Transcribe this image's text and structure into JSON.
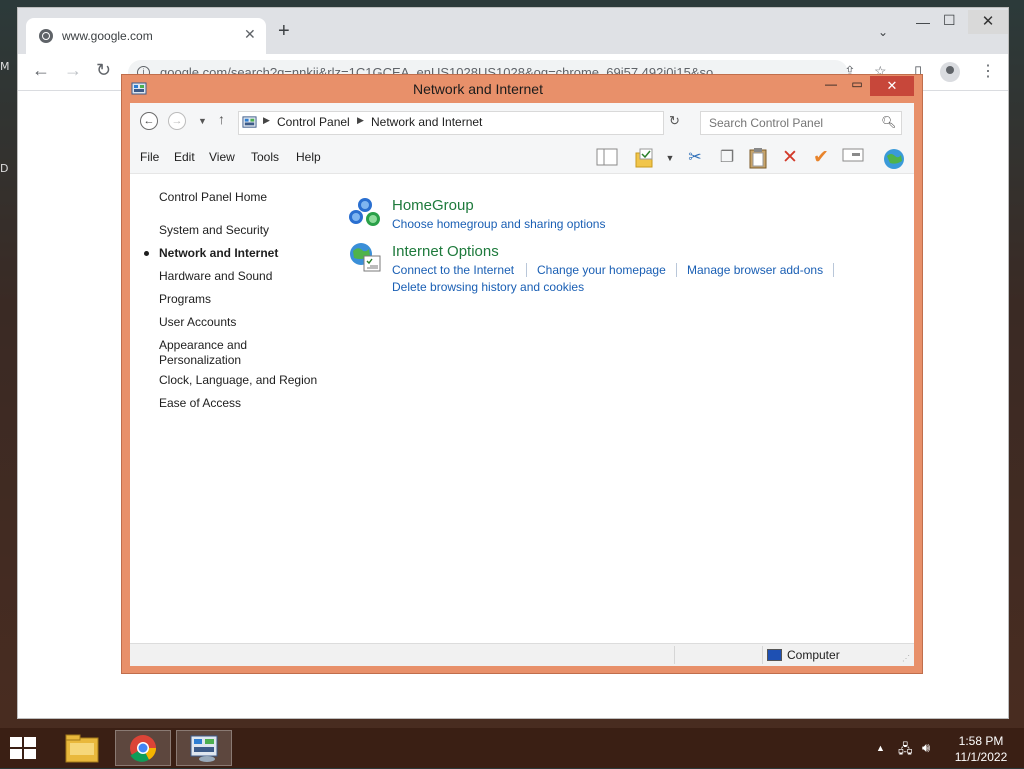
{
  "desktop": {
    "label_1": "M",
    "label_2": "D"
  },
  "browser": {
    "tab_title": "www.google.com",
    "tab_close": "✕",
    "new_tab": "+",
    "url": "google.com/search?q=nnkii&rlz=1C1GCEA_enUS1028US1028&oq=chrome_69i57.492j0j15&so",
    "window_minimize": "—",
    "window_maximize": "☐",
    "window_close": "✕"
  },
  "control_panel": {
    "title": "Network and Internet",
    "breadcrumb": [
      "Control Panel",
      "Network and Internet"
    ],
    "search_placeholder": "Search Control Panel",
    "menu": [
      "File",
      "Edit",
      "View",
      "Tools",
      "Help"
    ],
    "nav_links": [
      "Control Panel Home",
      "System and Security",
      "Network and Internet",
      "Hardware and Sound",
      "Programs",
      "User Accounts",
      "Appearance and Personalization",
      "Clock, Language, and Region",
      "Ease of Access"
    ],
    "active_nav_index": 2,
    "categories": [
      {
        "title": "HomeGroup",
        "links": [
          "Choose homegroup and sharing options"
        ]
      },
      {
        "title": "Internet Options",
        "links": [
          "Connect to the Internet",
          "Change your homepage",
          "Manage browser add-ons",
          "Delete browsing history and cookies"
        ]
      }
    ],
    "status_text": "Computer"
  },
  "taskbar": {
    "clock_time": "1:58 PM",
    "clock_date": "11/1/2022"
  },
  "colors": {
    "window_frame": "#e8906a",
    "close_button": "#c7473a",
    "category_title": "#1e7a3c",
    "link": "#1a5fb4",
    "taskbar": "#3a1f14"
  }
}
